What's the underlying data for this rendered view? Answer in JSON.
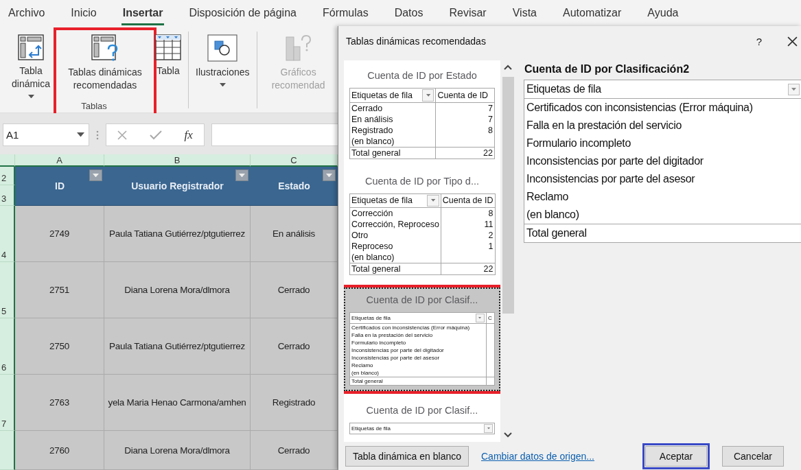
{
  "menu_tabs": [
    {
      "label": "Archivo",
      "selected": false
    },
    {
      "label": "Inicio",
      "selected": false
    },
    {
      "label": "Insertar",
      "selected": true
    },
    {
      "label": "Disposición de página",
      "selected": false
    },
    {
      "label": "Fórmulas",
      "selected": false
    },
    {
      "label": "Datos",
      "selected": false
    },
    {
      "label": "Revisar",
      "selected": false
    },
    {
      "label": "Vista",
      "selected": false
    },
    {
      "label": "Automatizar",
      "selected": false
    },
    {
      "label": "Ayuda",
      "selected": false
    }
  ],
  "ribbon": {
    "groups": [
      {
        "label": "Tablas",
        "items": [
          {
            "kind": "pivot",
            "label": "Tabla dinámica",
            "dropdown": true,
            "disabled": false
          },
          {
            "kind": "recommended",
            "label": "Tablas dinámicas recomendadas",
            "dropdown": false,
            "annotated": true,
            "disabled": false
          },
          {
            "kind": "table",
            "label": "Tabla",
            "dropdown": false,
            "disabled": false
          }
        ]
      },
      {
        "items": [
          {
            "kind": "illustrations",
            "label": "Ilustraciones",
            "dropdown": true,
            "disabled": false
          }
        ]
      },
      {
        "items": [
          {
            "kind": "charts",
            "label": "Gráficos recomendad",
            "dropdown": false,
            "disabled": true
          }
        ]
      }
    ]
  },
  "formula_bar": {
    "name_box": "A1",
    "function_label": "fx"
  },
  "sheet": {
    "columns": [
      "A",
      "B",
      "C"
    ],
    "row_numbers": [
      "2",
      "3",
      "4",
      "5",
      "6",
      "7"
    ],
    "header": [
      "ID",
      "Usuario Registrador",
      "Estado"
    ],
    "rows": [
      [
        "2749",
        "Paula Tatiana Gutiérrez/ptgutierrez",
        "En análisis"
      ],
      [
        "2751",
        "Diana Lorena Mora/dlmora",
        "Cerrado"
      ],
      [
        "2750",
        "Paula Tatiana Gutiérrez/ptgutierrez",
        "Cerrado"
      ],
      [
        "2763",
        "yela Maria Henao Carmona/amhen",
        "Registrado"
      ],
      [
        "2760",
        "Diana Lorena Mora/dlmora",
        "Cerrado"
      ]
    ]
  },
  "dialog": {
    "title": "Tablas dinámicas recomendadas",
    "help": "?",
    "recommendations": [
      {
        "title": "Cuenta de ID por Estado",
        "selected": false,
        "annotated": false,
        "columns": [
          "Etiquetas de fila",
          "Cuenta de ID"
        ],
        "rows": [
          {
            "label": "Cerrado",
            "value": "7"
          },
          {
            "label": "En análisis",
            "value": "7"
          },
          {
            "label": "Registrado",
            "value": "8"
          },
          {
            "label": "(en blanco)"
          }
        ],
        "total": {
          "label": "Total general",
          "value": "22"
        }
      },
      {
        "title": "Cuenta de ID por Tipo d...",
        "selected": false,
        "annotated": false,
        "columns": [
          "Etiquetas de fila",
          "Cuenta de ID"
        ],
        "rows": [
          {
            "label": "Corrección",
            "value": "8"
          },
          {
            "label": "Corrección, Reproceso",
            "value": "11"
          },
          {
            "label": "Otro",
            "value": "2"
          },
          {
            "label": "Reproceso",
            "value": "1"
          },
          {
            "label": "(en blanco)"
          }
        ],
        "total": {
          "label": "Total general",
          "value": "22"
        }
      },
      {
        "title": "Cuenta de ID por Clasif...",
        "selected": true,
        "annotated": true,
        "columns": [
          "Etiquetas de fila",
          "C"
        ],
        "rows": [
          {
            "label": "Certificados con inconsistencias (Error máquina)"
          },
          {
            "label": "Falla en la prestación del servicio"
          },
          {
            "label": "Formulario incompleto"
          },
          {
            "label": "Inconsistencias  por parte del digitador"
          },
          {
            "label": "Inconsistencias por parte del asesor"
          },
          {
            "label": "Reclamo"
          },
          {
            "label": "(en blanco)"
          }
        ],
        "total": {
          "label": "Total general"
        }
      },
      {
        "title": "Cuenta de ID por Clasif...",
        "selected": false,
        "annotated": false,
        "columns": [
          "Etiquetas de fila"
        ]
      }
    ],
    "preview": {
      "title": "Cuenta de ID por Clasificación2",
      "columns": [
        "Etiquetas de fila"
      ],
      "rows": [
        {
          "label": "Certificados con inconsistencias (Error máquina)"
        },
        {
          "label": "Falla en la prestación del servicio"
        },
        {
          "label": "Formulario incompleto"
        },
        {
          "label": "Inconsistencias  por parte del digitador"
        },
        {
          "label": "Inconsistencias por parte del asesor"
        },
        {
          "label": "Reclamo"
        },
        {
          "label": "(en blanco)"
        }
      ],
      "total": {
        "label": "Total general"
      }
    },
    "buttons": [
      {
        "kind": "button",
        "label": "Tabla dinámica en blanco"
      },
      {
        "kind": "link",
        "label": "Cambiar datos de origen..."
      },
      {
        "kind": "button",
        "label": "Aceptar",
        "annotated": true
      },
      {
        "kind": "button",
        "label": "Cancelar"
      }
    ]
  }
}
